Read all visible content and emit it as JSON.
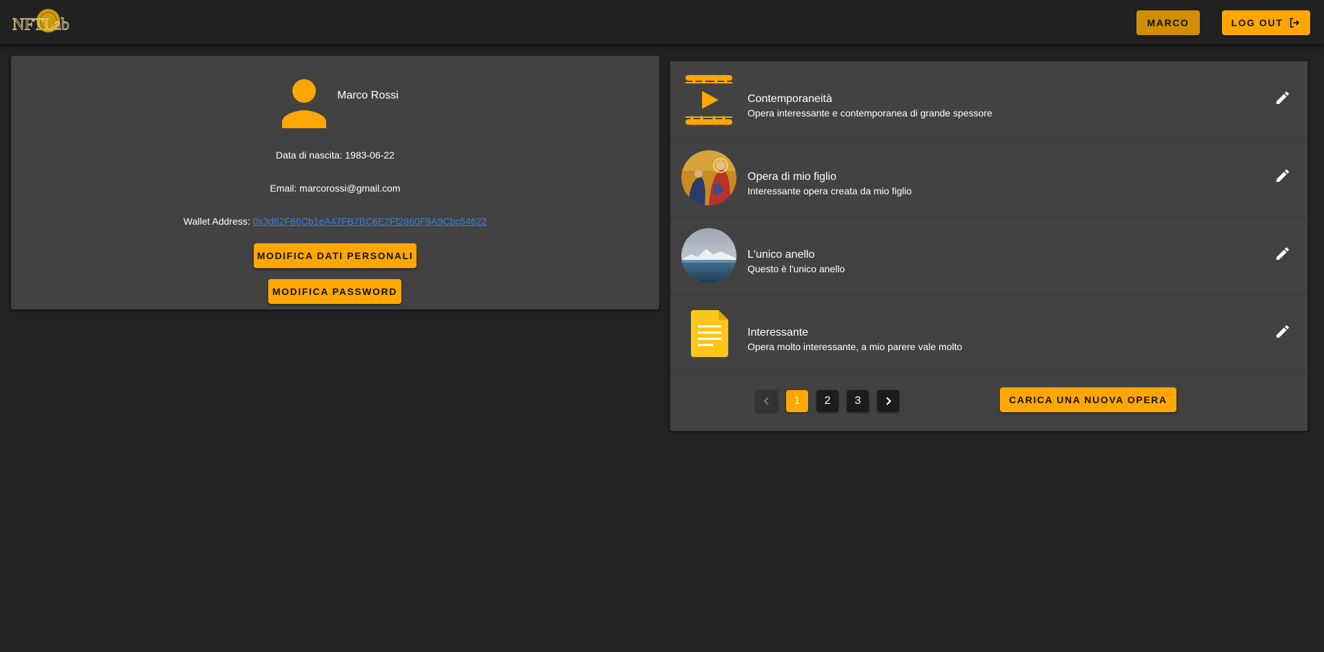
{
  "app": {
    "logo_text": "NFTLab"
  },
  "header": {
    "user_label": "MARCO",
    "logout_label": "LOG OUT",
    "logout_icon": "logout-icon"
  },
  "profile": {
    "avatar_icon": "person-icon",
    "name": "Marco Rossi",
    "birth_label": "Data di nascita:",
    "birth_value": "1983-06-22",
    "email_label": "Email:",
    "email_value": "marcorossi@gmail.com",
    "wallet_label": "Wallet Address:",
    "wallet_value": "0x3d62F66Cb1eA47FB7BC6E2Ff2860F9A9Cbc54622",
    "edit_data_label": "MODIFICA DATI PERSONALI",
    "edit_password_label": "MODIFICA PASSWORD"
  },
  "works": {
    "items": [
      {
        "title": "Contemporaneità",
        "description": "Opera interessante e contemporanea di grande spessore",
        "thumb": "video-file-icon"
      },
      {
        "title": "Opera di mio figlio",
        "description": "Interessante opera creata da mio figlio",
        "thumb": "painting-image"
      },
      {
        "title": "L'unico anello",
        "description": "Questo è l'unico anello",
        "thumb": "mountain-lake-image"
      },
      {
        "title": "Interessante",
        "description": "Opera molto interessante, a mio parere vale molto",
        "thumb": "text-document-icon"
      }
    ],
    "pagination": {
      "pages": [
        "1",
        "2",
        "3"
      ],
      "current": "1"
    },
    "upload_label": "CARICA UNA NUOVA OPERA"
  },
  "colors": {
    "background": "#222222",
    "card": "#424242",
    "accent": "#ffa700",
    "accent_dark": "#d08e00",
    "link": "#3f7fd6"
  }
}
